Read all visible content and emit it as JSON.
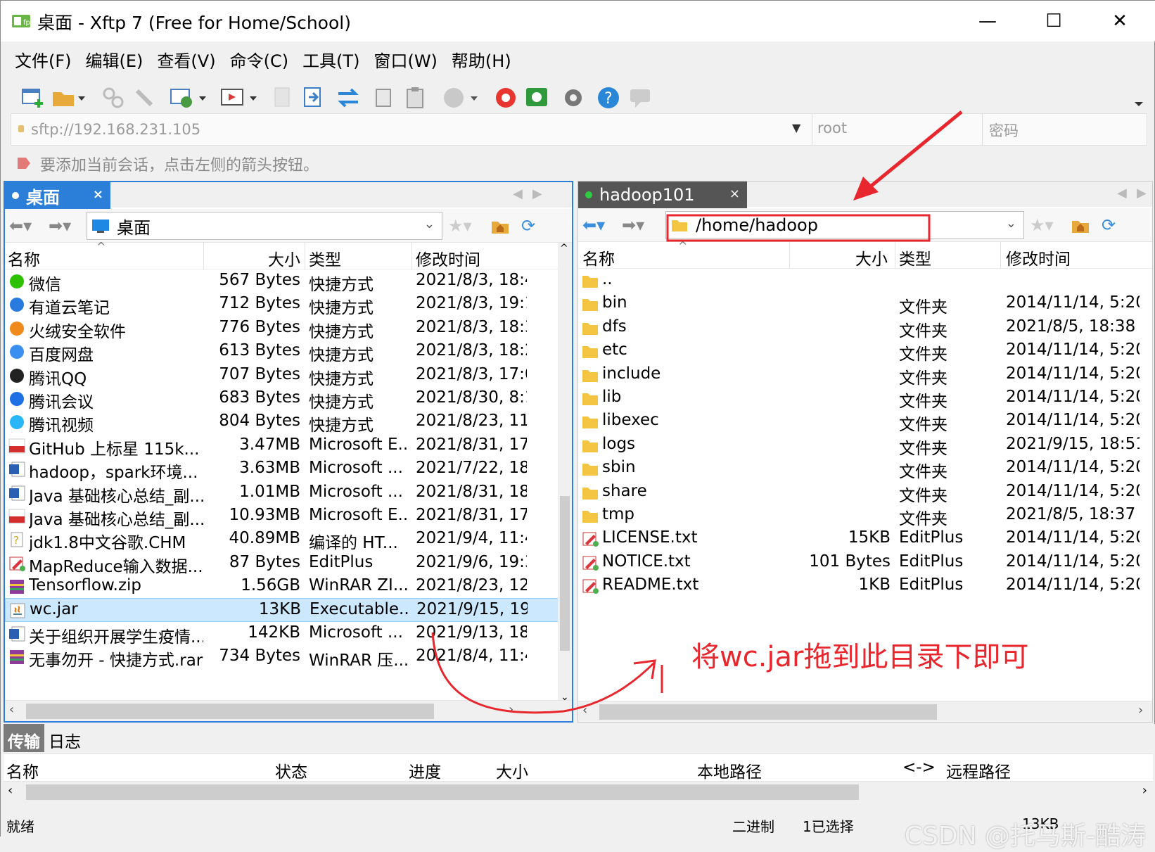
{
  "window": {
    "title": "桌面 - Xftp 7 (Free for Home/School)",
    "controls": {
      "minimize": "—",
      "maximize": "☐",
      "close": "✕"
    }
  },
  "menu": [
    "文件(F)",
    "编辑(E)",
    "查看(V)",
    "命令(C)",
    "工具(T)",
    "窗口(W)",
    "帮助(H)"
  ],
  "address": {
    "url": "sftp://192.168.231.105",
    "user": "root",
    "password_placeholder": "密码"
  },
  "hint": "要添加当前会话，点击左侧的箭头按钮。",
  "left": {
    "tab": "桌面",
    "path": "桌面",
    "columns": {
      "name": "名称",
      "size": "大小",
      "type": "类型",
      "modified": "修改时间"
    },
    "files": [
      {
        "name": "微信",
        "size": "567 Bytes",
        "type": "快捷方式",
        "modified": "2021/8/3, 18:4",
        "icon": "wechat-icon",
        "color": "#2dc100"
      },
      {
        "name": "有道云笔记",
        "size": "712 Bytes",
        "type": "快捷方式",
        "modified": "2021/8/3, 19:1",
        "icon": "note-icon",
        "color": "#2a7be0"
      },
      {
        "name": "火绒安全软件",
        "size": "776 Bytes",
        "type": "快捷方式",
        "modified": "2021/8/3, 18:3",
        "icon": "shield-icon",
        "color": "#f08a1c"
      },
      {
        "name": "百度网盘",
        "size": "613 Bytes",
        "type": "快捷方式",
        "modified": "2021/8/3, 18:2",
        "icon": "cloud-icon",
        "color": "#3b8ff0"
      },
      {
        "name": "腾讯QQ",
        "size": "707 Bytes",
        "type": "快捷方式",
        "modified": "2021/8/3, 17:0",
        "icon": "penguin-icon",
        "color": "#222222"
      },
      {
        "name": "腾讯会议",
        "size": "683 Bytes",
        "type": "快捷方式",
        "modified": "2021/8/30, 8:1",
        "icon": "meeting-icon",
        "color": "#1f6fe5"
      },
      {
        "name": "腾讯视频",
        "size": "804 Bytes",
        "type": "快捷方式",
        "modified": "2021/8/23, 11:",
        "icon": "play-icon",
        "color": "#29b6f6"
      },
      {
        "name": "GitHub 上标星 115k...",
        "size": "3.47MB",
        "type": "Microsoft E...",
        "modified": "2021/8/31, 17:",
        "icon": "pdf-icon",
        "color": "#d32f2f"
      },
      {
        "name": "hadoop，spark环境...",
        "size": "3.63MB",
        "type": "Microsoft ...",
        "modified": "2021/7/22, 18:",
        "icon": "word-icon",
        "color": "#2b5fb3"
      },
      {
        "name": "Java 基础核心总结_副...",
        "size": "1.01MB",
        "type": "Microsoft ...",
        "modified": "2021/8/31, 18:",
        "icon": "word-icon",
        "color": "#2b5fb3"
      },
      {
        "name": "Java 基础核心总结_副...",
        "size": "10.93MB",
        "type": "Microsoft E...",
        "modified": "2021/8/31, 17:",
        "icon": "pdf-icon",
        "color": "#d32f2f"
      },
      {
        "name": "jdk1.8中文谷歌.CHM",
        "size": "40.89MB",
        "type": "编译的 HT...",
        "modified": "2021/9/4, 11:4",
        "icon": "help-icon",
        "color": "#c9a227"
      },
      {
        "name": "MapReduce输入数据....",
        "size": "87 Bytes",
        "type": "EditPlus",
        "modified": "2021/9/6, 19:3",
        "icon": "editplus-icon",
        "color": "#d9363e"
      },
      {
        "name": "Tensorflow.zip",
        "size": "1.56GB",
        "type": "WinRAR ZI...",
        "modified": "2021/8/23, 12:",
        "icon": "archive-icon",
        "color": "#8e3b9c"
      },
      {
        "name": "wc.jar",
        "size": "13KB",
        "type": "Executable...",
        "modified": "2021/9/15, 19:",
        "icon": "java-icon",
        "color": "#b07219",
        "selected": true
      },
      {
        "name": "关于组织开展学生疫情...",
        "size": "142KB",
        "type": "Microsoft ...",
        "modified": "2021/9/13, 18:",
        "icon": "word-icon",
        "color": "#2b5fb3"
      },
      {
        "name": "无事勿开 - 快捷方式.rar",
        "size": "734 Bytes",
        "type": "WinRAR 压...",
        "modified": "2021/8/4, 11:4",
        "icon": "archive-icon",
        "color": "#8e3b9c"
      }
    ]
  },
  "right": {
    "tab": "hadoop101",
    "path": "/home/hadoop",
    "columns": {
      "name": "名称",
      "size": "大小",
      "type": "类型",
      "modified": "修改时间"
    },
    "files": [
      {
        "name": "..",
        "size": "",
        "type": "",
        "modified": "",
        "icon": "folder-icon"
      },
      {
        "name": "bin",
        "size": "",
        "type": "文件夹",
        "modified": "2014/11/14, 5:20",
        "icon": "folder-icon"
      },
      {
        "name": "dfs",
        "size": "",
        "type": "文件夹",
        "modified": "2021/8/5, 18:38",
        "icon": "folder-icon"
      },
      {
        "name": "etc",
        "size": "",
        "type": "文件夹",
        "modified": "2014/11/14, 5:20",
        "icon": "folder-icon"
      },
      {
        "name": "include",
        "size": "",
        "type": "文件夹",
        "modified": "2014/11/14, 5:20",
        "icon": "folder-icon"
      },
      {
        "name": "lib",
        "size": "",
        "type": "文件夹",
        "modified": "2014/11/14, 5:20",
        "icon": "folder-icon"
      },
      {
        "name": "libexec",
        "size": "",
        "type": "文件夹",
        "modified": "2014/11/14, 5:20",
        "icon": "folder-icon"
      },
      {
        "name": "logs",
        "size": "",
        "type": "文件夹",
        "modified": "2021/9/15, 18:51",
        "icon": "folder-icon"
      },
      {
        "name": "sbin",
        "size": "",
        "type": "文件夹",
        "modified": "2014/11/14, 5:20",
        "icon": "folder-icon"
      },
      {
        "name": "share",
        "size": "",
        "type": "文件夹",
        "modified": "2014/11/14, 5:20",
        "icon": "folder-icon"
      },
      {
        "name": "tmp",
        "size": "",
        "type": "文件夹",
        "modified": "2021/8/5, 18:37",
        "icon": "folder-icon"
      },
      {
        "name": "LICENSE.txt",
        "size": "15KB",
        "type": "EditPlus",
        "modified": "2014/11/14, 5:20",
        "icon": "editplus-icon"
      },
      {
        "name": "NOTICE.txt",
        "size": "101 Bytes",
        "type": "EditPlus",
        "modified": "2014/11/14, 5:20",
        "icon": "editplus-icon"
      },
      {
        "name": "README.txt",
        "size": "1KB",
        "type": "EditPlus",
        "modified": "2014/11/14, 5:20",
        "icon": "editplus-icon"
      }
    ]
  },
  "transfer": {
    "tabs": [
      "传输",
      "日志"
    ],
    "columns": [
      "名称",
      "状态",
      "进度",
      "大小",
      "本地路径",
      "<->",
      "远程路径"
    ]
  },
  "status": {
    "ready": "就绪",
    "mode": "二进制",
    "selected": "1已选择",
    "size": "13KB"
  },
  "annotation": {
    "text": "将wc.jar拖到此目录下即可",
    "color": "#e8262d"
  },
  "watermark": "CSDN @托马斯-酷涛"
}
